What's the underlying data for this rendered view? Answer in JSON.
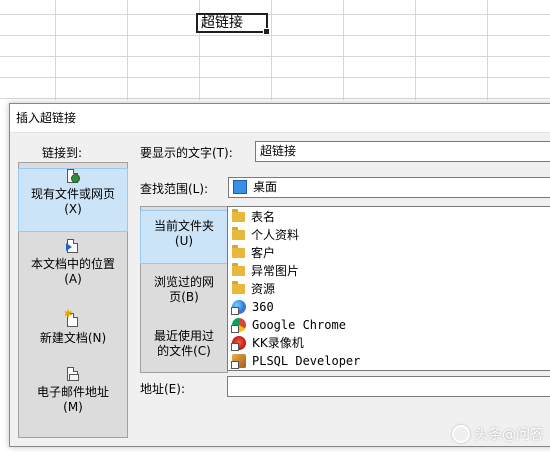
{
  "sheet": {
    "active_cell_text": "超链接"
  },
  "dialog": {
    "title": "插入超链接",
    "link_to_label": "链接到:",
    "nav": [
      {
        "line1": "现有文件或网页",
        "line2": "(X)",
        "icon": "web-page-icon",
        "selected": true
      },
      {
        "line1": "本文档中的位置",
        "line2": "(A)",
        "icon": "place-in-document-icon",
        "selected": false
      },
      {
        "line1": "新建文档(N)",
        "line2": "",
        "icon": "new-document-icon",
        "selected": false
      },
      {
        "line1": "电子邮件地址",
        "line2": "(M)",
        "icon": "email-address-icon",
        "selected": false
      }
    ],
    "display_text_label": "要显示的文字(T):",
    "display_text_value": "超链接",
    "look_in_label": "查找范围(L):",
    "look_in_value": "桌面",
    "middle_nav": [
      {
        "line1": "当前文件夹",
        "line2": "(U)",
        "selected": true
      },
      {
        "line1": "浏览过的网",
        "line2": "页(B)",
        "selected": false
      },
      {
        "line1": "最近使用过",
        "line2": "的文件(C)",
        "selected": false
      }
    ],
    "files": [
      {
        "name": "表名",
        "icon": "folder-icon",
        "mono": false
      },
      {
        "name": "个人资料",
        "icon": "folder-icon",
        "mono": false
      },
      {
        "name": "客户",
        "icon": "folder-icon",
        "mono": false
      },
      {
        "name": "异常图片",
        "icon": "folder-icon",
        "mono": false
      },
      {
        "name": "资源",
        "icon": "folder-icon",
        "mono": false
      },
      {
        "name": "360",
        "icon": "360-browser-icon",
        "mono": true
      },
      {
        "name": "Google Chrome",
        "icon": "chrome-icon",
        "mono": true
      },
      {
        "name": "KK录像机",
        "icon": "kk-recorder-icon",
        "mono": true
      },
      {
        "name": "PLSQL Developer",
        "icon": "plsql-developer-icon",
        "mono": true
      }
    ],
    "address_label": "地址(E):",
    "address_value": ""
  },
  "watermark": "头条@问答",
  "colors": {
    "selection": "#cce4f7",
    "panel": "#dcdcdc",
    "dialog_bg": "#f0f0f0",
    "folder": "#e7b83b"
  }
}
